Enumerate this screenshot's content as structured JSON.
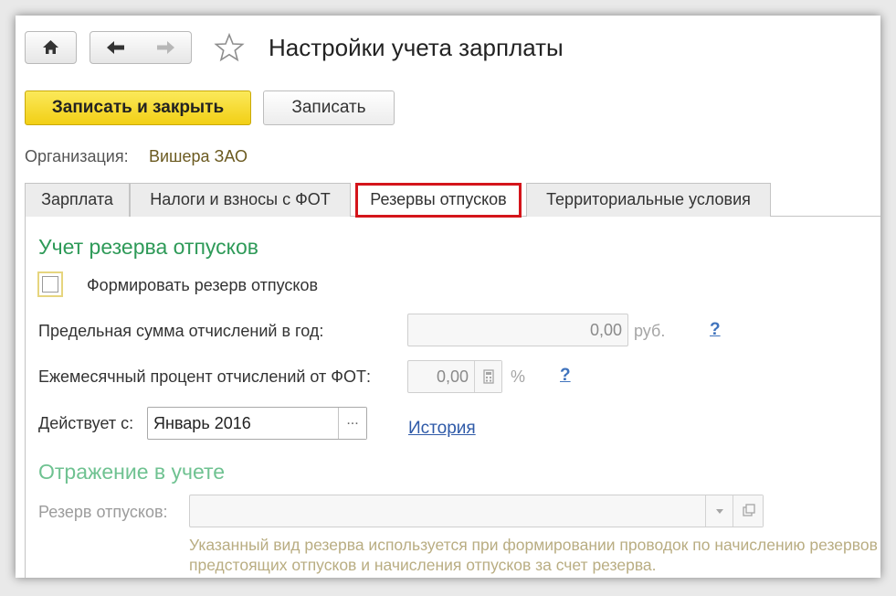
{
  "window": {
    "title": "Настройки учета зарплаты"
  },
  "toolbar": {
    "save_close_label": "Записать и закрыть",
    "save_label": "Записать"
  },
  "organization": {
    "label": "Организация:",
    "value": "Вишера ЗАО"
  },
  "tabs": [
    {
      "label": "Зарплата",
      "active": false
    },
    {
      "label": "Налоги и взносы с ФОТ",
      "active": false
    },
    {
      "label": "Резервы отпусков",
      "active": true
    },
    {
      "label": "Территориальные условия",
      "active": false
    }
  ],
  "reserve_section": {
    "title": "Учет резерва отпусков",
    "checkbox_label": "Формировать резерв отпусков",
    "checkbox_checked": false,
    "limit_label": "Предельная сумма отчислений в год:",
    "limit_value": "0,00",
    "limit_unit": "руб.",
    "percent_label": "Ежемесячный процент отчислений от ФОТ:",
    "percent_value": "0,00",
    "percent_unit": "%",
    "help_mark": "?",
    "effective_label": "Действует с:",
    "effective_value": "Январь 2016",
    "select_button": "...",
    "history_link": "История"
  },
  "accounting_section": {
    "title": "Отражение в учете",
    "reserve_label": "Резерв отпусков:",
    "reserve_value": "",
    "note": "Указанный вид резерва используется при формировании проводок по начислению резервов предстоящих отпусков и начисления отпусков за счет резерва."
  },
  "colors": {
    "primary_button": "#f2cf15",
    "section_title": "#2e9a58",
    "active_tab_highlight": "#d4151b",
    "link": "#2f5aa8"
  }
}
